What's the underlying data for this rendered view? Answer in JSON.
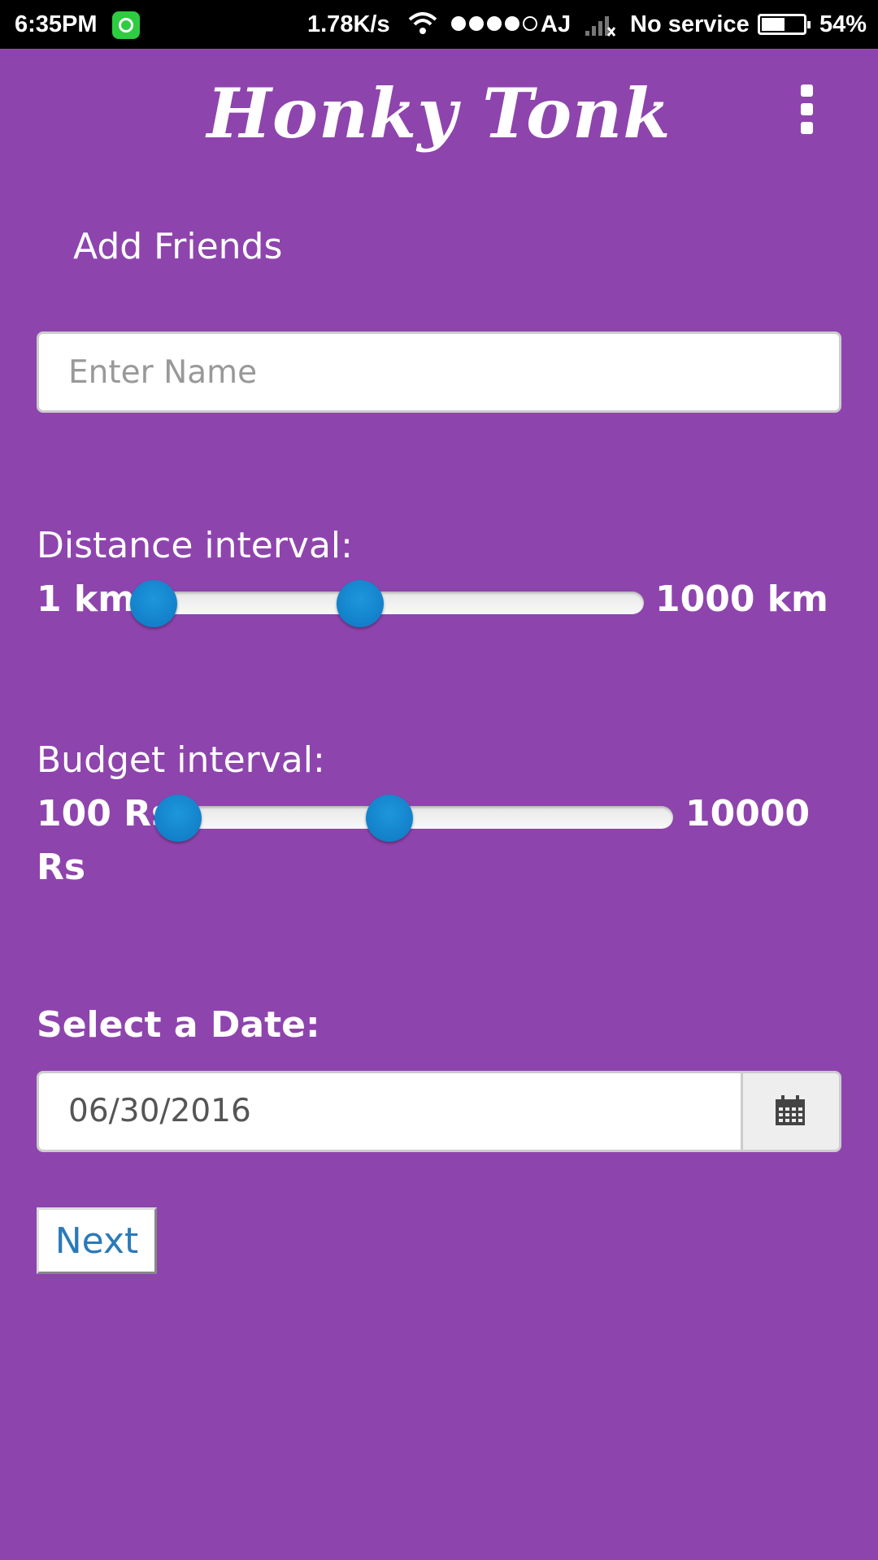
{
  "status_bar": {
    "time": "6:35PM",
    "speed": "1.78K/s",
    "carrier": "AJ",
    "service": "No service",
    "battery": "54%",
    "battery_level": 0.54
  },
  "header": {
    "title": "Honky Tonk",
    "menu_icon": "kebab-menu-icon"
  },
  "add_friends": {
    "heading": "Add Friends",
    "name_placeholder": "Enter Name"
  },
  "distance": {
    "label": "Distance interval:",
    "min_label": "1 km",
    "max_label": "1000 km"
  },
  "budget": {
    "label": "Budget interval:",
    "min_label_line1": "100 Rs",
    "max_label_line1": "10000",
    "max_label_line2": "Rs"
  },
  "date": {
    "label": "Select a Date:",
    "value": "06/30/2016",
    "icon": "calendar-icon"
  },
  "actions": {
    "next_label": "Next"
  },
  "colors": {
    "background": "#8e44ad",
    "slider_thumb": "#1287d0",
    "link": "#2a7ab8"
  }
}
